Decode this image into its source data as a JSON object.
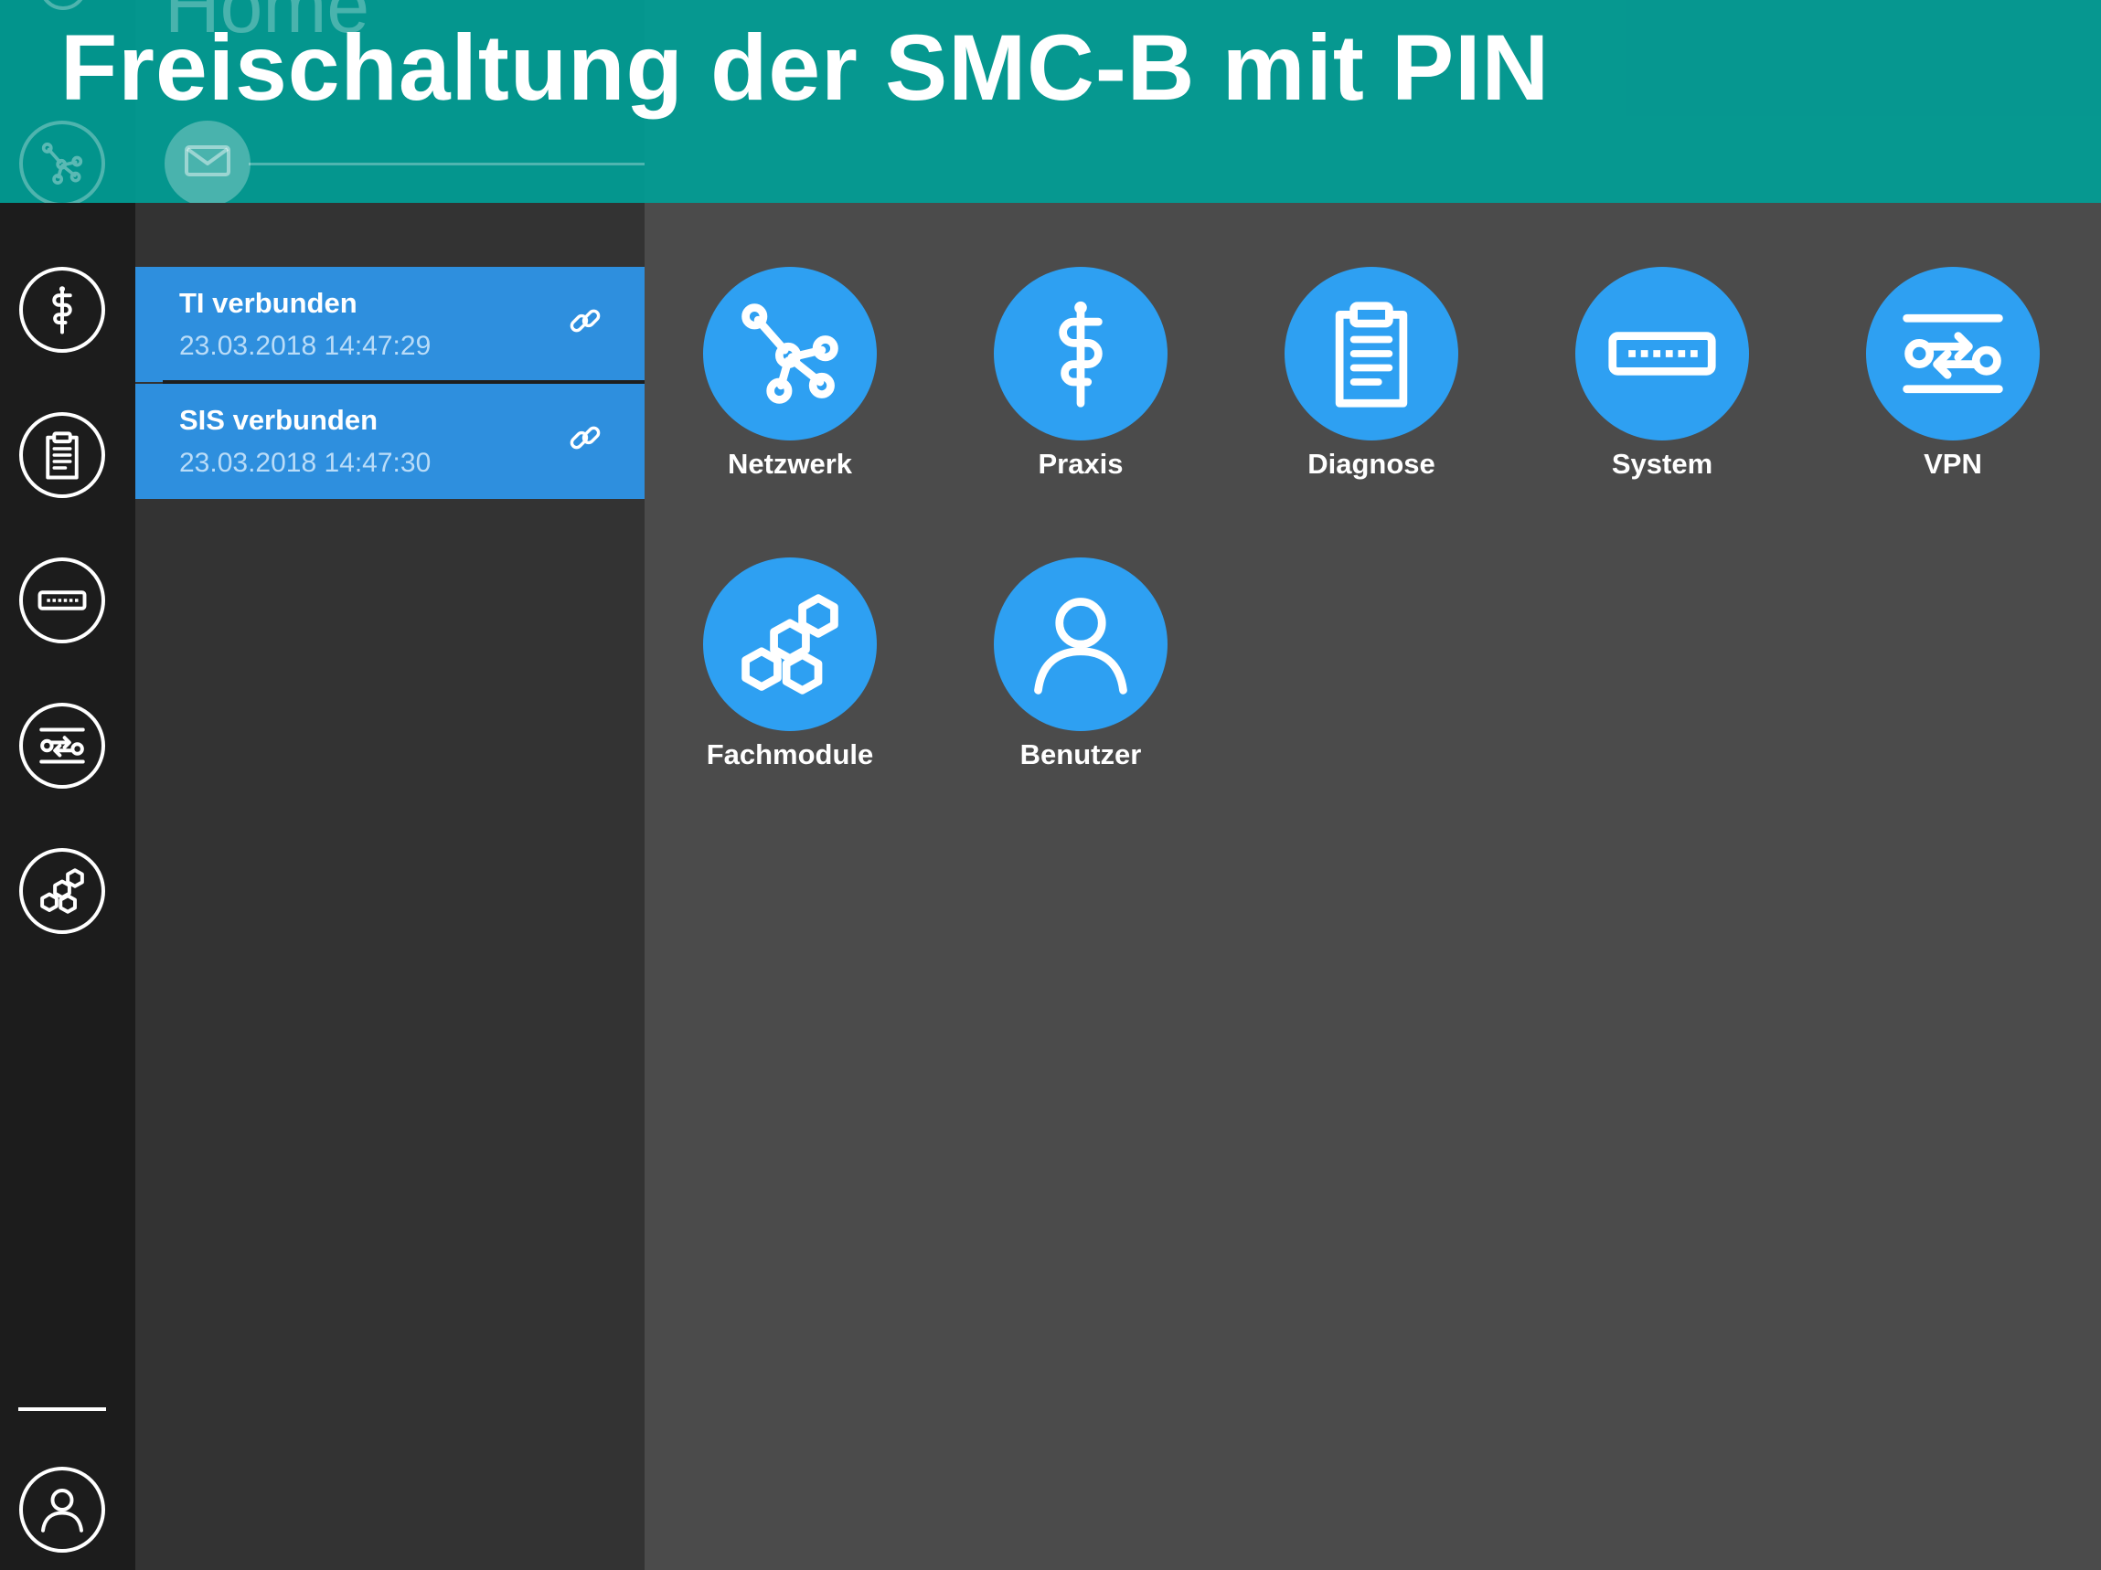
{
  "banner": {
    "title": "Freischaltung der SMC-B mit PIN",
    "background_page_title": "Home"
  },
  "rail": {
    "items": [
      {
        "icon": "network-icon"
      },
      {
        "icon": "caduceus-icon"
      },
      {
        "icon": "clipboard-icon"
      },
      {
        "icon": "router-icon"
      },
      {
        "icon": "vpn-icon"
      },
      {
        "icon": "modules-icon"
      }
    ],
    "user_icon": "user-icon"
  },
  "status": {
    "items": [
      {
        "title": "TI verbunden",
        "time": "23.03.2018 14:47:29",
        "icon": "link-icon"
      },
      {
        "title": "SIS verbunden",
        "time": "23.03.2018 14:47:30",
        "icon": "link-icon"
      }
    ]
  },
  "tiles": [
    {
      "label": "Netzwerk",
      "icon": "network-icon"
    },
    {
      "label": "Praxis",
      "icon": "caduceus-icon"
    },
    {
      "label": "Diagnose",
      "icon": "clipboard-icon"
    },
    {
      "label": "System",
      "icon": "router-icon"
    },
    {
      "label": "VPN",
      "icon": "vpn-icon"
    },
    {
      "label": "Fachmodule",
      "icon": "modules-icon"
    },
    {
      "label": "Benutzer",
      "icon": "user-icon"
    }
  ],
  "colors": {
    "accent": "#2ea0f2",
    "status_bg": "#2e8fde",
    "banner": "#009e96"
  }
}
